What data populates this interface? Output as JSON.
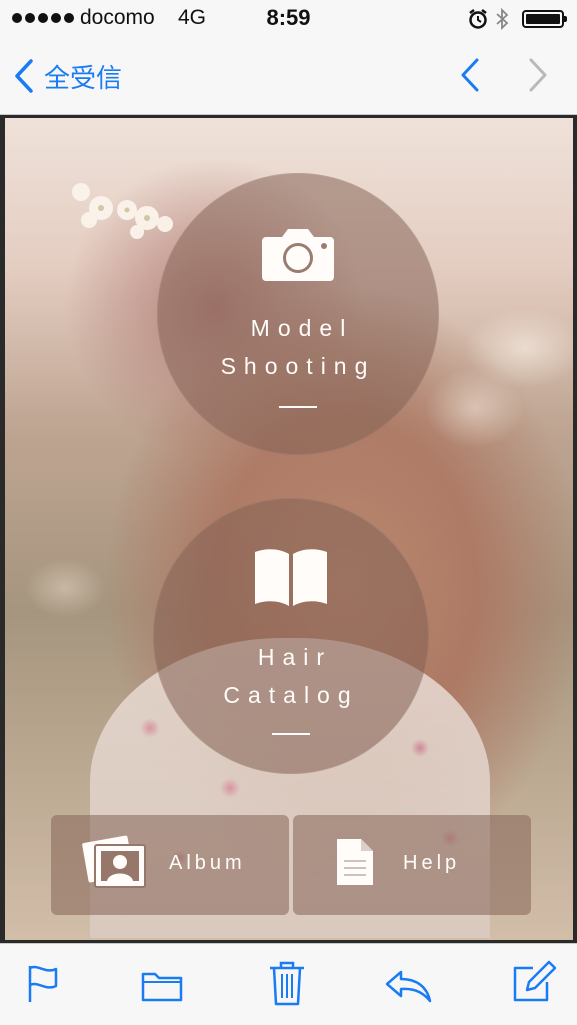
{
  "status_bar": {
    "carrier": "docomo",
    "network": "4G",
    "time": "8:59"
  },
  "nav": {
    "back_label": "全受信"
  },
  "menu": {
    "model_shooting": "Model\nShooting",
    "hair_catalog": "Hair\nCatalog",
    "album": "Album",
    "help": "Help"
  },
  "icons": {
    "status": [
      "signal-dots-icon",
      "alarm-icon",
      "bluetooth-icon",
      "battery-icon"
    ],
    "nav": [
      "chevron-left-icon",
      "chevron-up-icon",
      "chevron-down-icon"
    ],
    "menu": [
      "camera-icon",
      "book-icon",
      "photo-portrait-icon",
      "document-icon"
    ],
    "toolbar": [
      "flag-icon",
      "folder-icon",
      "trash-icon",
      "reply-icon",
      "compose-icon"
    ]
  },
  "colors": {
    "accent": "#1a7cf5",
    "disabled": "#b9b9b9"
  }
}
